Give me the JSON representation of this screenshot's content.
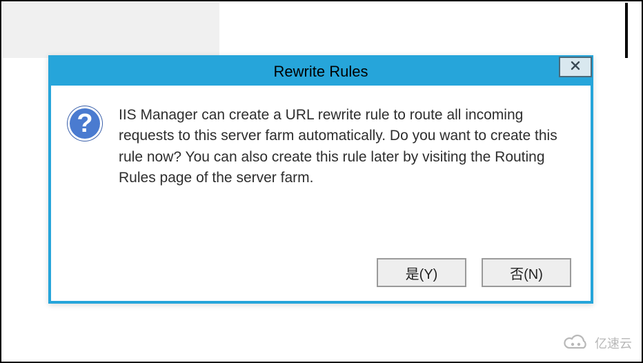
{
  "dialog": {
    "title": "Rewrite Rules",
    "message": "IIS Manager can create a URL rewrite rule to route all incoming requests to this server farm automatically. Do you want to create this rule now? You can also create this rule later by visiting the Routing Rules page of the server farm.",
    "close_label": "X",
    "buttons": {
      "yes": "是(Y)",
      "no": "否(N)"
    },
    "icon": "question-mark",
    "colors": {
      "accent": "#26a5da",
      "button_bg": "#eeeeee",
      "button_border": "#9a9a9a",
      "icon_fill": "#4a7bd0"
    }
  },
  "watermark": {
    "text": "亿速云",
    "icon": "cloud-icon"
  }
}
